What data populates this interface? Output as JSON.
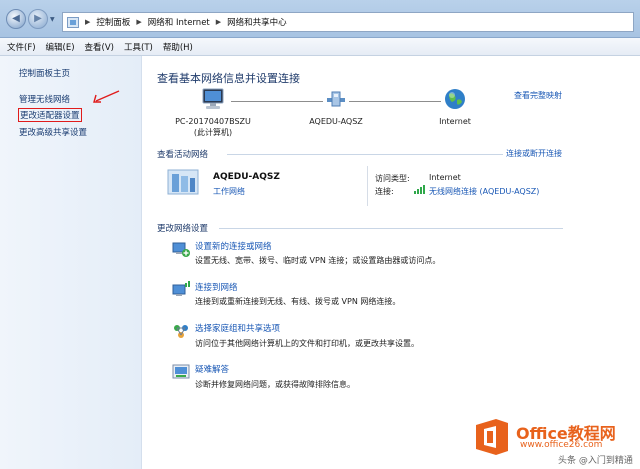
{
  "address_bar": {
    "crumbs": [
      "控制面板",
      "网络和 Internet",
      "网络和共享中心"
    ]
  },
  "menu": [
    "文件(F)",
    "编辑(E)",
    "查看(V)",
    "工具(T)",
    "帮助(H)"
  ],
  "left_panel": {
    "home": "控制面板主页",
    "items": [
      "管理无线网络",
      "更改适配器设置",
      "更改高级共享设置"
    ]
  },
  "main": {
    "title": "查看基本网络信息并设置连接",
    "full_map": "查看完整映射",
    "map": {
      "computer_name": "PC-20170407BSZU",
      "computer_sub": "(此计算机)",
      "network_name": "AQEDU-AQSZ",
      "internet": "Internet"
    },
    "active": {
      "heading": "查看活动网络",
      "connect_link": "连接或断开连接",
      "name": "AQEDU-AQSZ",
      "type": "工作网络",
      "access_label": "访问类型:",
      "access_value": "Internet",
      "conn_label": "连接:",
      "conn_value": "无线网络连接 (AQEDU-AQSZ)"
    },
    "change": {
      "heading": "更改网络设置",
      "tasks": [
        {
          "title": "设置新的连接或网络",
          "desc": "设置无线、宽带、拨号、临时或 VPN 连接；或设置路由器或访问点。"
        },
        {
          "title": "连接到网络",
          "desc": "连接到或重新连接到无线、有线、拨号或 VPN 网络连接。"
        },
        {
          "title": "选择家庭组和共享选项",
          "desc": "访问位于其他网络计算机上的文件和打印机，或更改共享设置。"
        },
        {
          "title": "疑难解答",
          "desc": "诊断并修复网络问题，或获得故障排除信息。"
        }
      ]
    }
  },
  "watermark": {
    "brand": "Office教程网",
    "url": "www.office26.com",
    "toutiao": "头条 @入门到精通"
  },
  "colors": {
    "link": "#1a58b5",
    "highlight_red": "#e01c1c",
    "watermark_orange": "#e8621c"
  }
}
